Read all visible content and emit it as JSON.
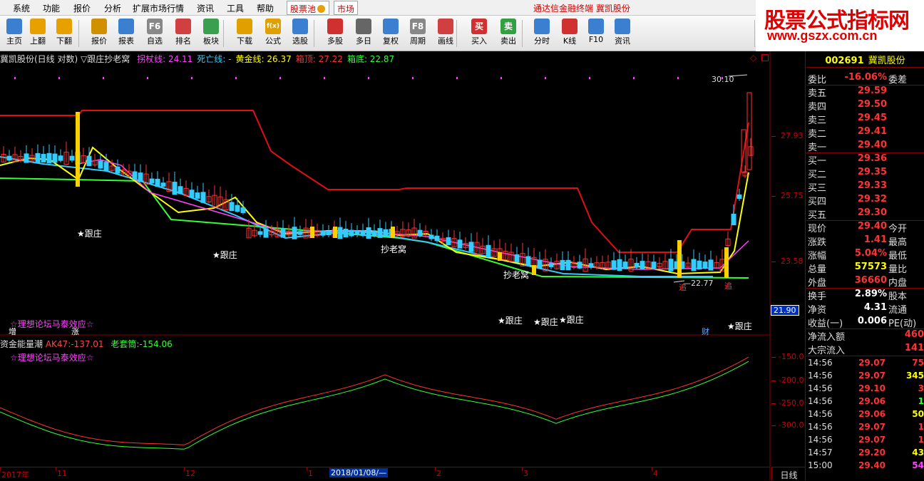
{
  "menu": {
    "items": [
      "系统",
      "功能",
      "报价",
      "分析",
      "扩展市场行情",
      "资讯",
      "工具",
      "帮助"
    ],
    "tab_pool": "股票池",
    "tab_market": "市场",
    "title": "通达信金融终端  冀凯股份"
  },
  "toolbar": {
    "buttons": [
      {
        "label": "主页",
        "icon": "home-icon"
      },
      {
        "label": "上翻",
        "icon": "up-arrow-icon"
      },
      {
        "label": "下翻",
        "icon": "down-arrow-icon"
      },
      {
        "label": "报价",
        "icon": "quote-icon"
      },
      {
        "label": "报表",
        "icon": "report-icon"
      },
      {
        "label": "自选",
        "icon": "f6-icon",
        "glyph": "F6"
      },
      {
        "label": "排名",
        "icon": "rank-icon"
      },
      {
        "label": "板块",
        "icon": "sector-icon"
      },
      {
        "label": "下载",
        "icon": "download-icon"
      },
      {
        "label": "公式",
        "icon": "formula-icon",
        "glyph": "f(x)"
      },
      {
        "label": "选股",
        "icon": "stock-select-icon"
      },
      {
        "label": "多股",
        "icon": "multi-stock-icon"
      },
      {
        "label": "多日",
        "icon": "multi-day-icon"
      },
      {
        "label": "复权",
        "icon": "restore-icon"
      },
      {
        "label": "周期",
        "icon": "f8-icon",
        "glyph": "F8"
      },
      {
        "label": "画线",
        "icon": "draw-line-icon"
      },
      {
        "label": "买入",
        "icon": "buy-icon",
        "glyph": "买"
      },
      {
        "label": "卖出",
        "icon": "sell-icon",
        "glyph": "卖"
      },
      {
        "label": "分时",
        "icon": "intraday-icon"
      },
      {
        "label": "K线",
        "icon": "kline-icon"
      },
      {
        "label": "F10",
        "icon": "f10-icon"
      },
      {
        "label": "资讯",
        "icon": "news-icon"
      }
    ]
  },
  "brand": {
    "title": "股票公式指标网",
    "url": "www.gszx.com.cn"
  },
  "price_header": {
    "name": "冀凯股份(日线 对数)",
    "formula": "▽跟庄抄老窝",
    "items": [
      {
        "label": "拐杖线:",
        "value": "24.11",
        "color": "#ff44ff"
      },
      {
        "label": "死亡线:",
        "value": "-",
        "color": "#33ccff"
      },
      {
        "label": "黄金线:",
        "value": "26.37",
        "color": "#ffff00"
      },
      {
        "label": "箱顶:",
        "value": "27.22",
        "color": "#ff3333"
      },
      {
        "label": "箱底:",
        "value": "22.87",
        "color": "#33ff33"
      }
    ]
  },
  "price_axis": [
    "27.93",
    "25.75",
    "23.58",
    "21.90"
  ],
  "price_markers": {
    "high": "30.10",
    "low": "22.77"
  },
  "chart_labels": {
    "gen_zhuang": "★跟庄",
    "chao_lao_wo": "抄老窝",
    "forum": "☆理想论坛马泰效应☆",
    "zeng": "增",
    "zhang": "涨",
    "cai": "财",
    "zhui": "追"
  },
  "indicator_header": {
    "name": "资金能量潮",
    "ak_label": "AK47:",
    "ak_value": "-137.01",
    "lt_label": "老套筒:",
    "lt_value": "-154.06",
    "forum": "☆理想论坛马泰效应☆"
  },
  "indicator_axis": [
    "-150.0",
    "-200.0",
    "-250.0",
    "-300.0"
  ],
  "x_axis": [
    "2017年",
    "11",
    "12",
    "1",
    "2018/01/08/—",
    "2",
    "3",
    "4"
  ],
  "period_label": "日线",
  "quote": {
    "code": "002691",
    "name": "冀凯股份",
    "weibi": {
      "label": "委比",
      "value": "-16.06%",
      "right": "委差"
    },
    "asks": [
      {
        "label": "卖五",
        "price": "29.59"
      },
      {
        "label": "卖四",
        "price": "29.50"
      },
      {
        "label": "卖三",
        "price": "29.45"
      },
      {
        "label": "卖二",
        "price": "29.41"
      },
      {
        "label": "卖一",
        "price": "29.40"
      }
    ],
    "bids": [
      {
        "label": "买一",
        "price": "29.36"
      },
      {
        "label": "买二",
        "price": "29.35"
      },
      {
        "label": "买三",
        "price": "29.33"
      },
      {
        "label": "买四",
        "price": "29.32"
      },
      {
        "label": "买五",
        "price": "29.30"
      }
    ],
    "stats": [
      {
        "label": "现价",
        "value": "29.40",
        "color": "#ff3333",
        "right": "今开"
      },
      {
        "label": "涨跌",
        "value": "1.41",
        "color": "#ff3333",
        "right": "最高"
      },
      {
        "label": "涨幅",
        "value": "5.04%",
        "color": "#ff3333",
        "right": "最低"
      },
      {
        "label": "总量",
        "value": "57573",
        "color": "#ffff00",
        "right": "量比"
      },
      {
        "label": "外盘",
        "value": "36660",
        "color": "#ff3333",
        "right": "内盘"
      }
    ],
    "stats2": [
      {
        "label": "换手",
        "value": "2.89%",
        "color": "#ffffff",
        "right": "股本"
      },
      {
        "label": "净资",
        "value": "4.31",
        "color": "#ffffff",
        "right": "流通"
      },
      {
        "label": "收益(一)",
        "value": "0.006",
        "color": "#ffffff",
        "right": "PE(动)"
      }
    ],
    "flows": [
      {
        "label": "净流入额",
        "value": "460"
      },
      {
        "label": "大宗流入",
        "value": "141"
      }
    ],
    "ticks": [
      {
        "time": "14:56",
        "price": "29.07",
        "vol": "75",
        "color": "#ff3333"
      },
      {
        "time": "14:56",
        "price": "29.07",
        "vol": "345",
        "color": "#ffff00"
      },
      {
        "time": "14:56",
        "price": "29.10",
        "vol": "3",
        "color": "#ff3333"
      },
      {
        "time": "14:56",
        "price": "29.06",
        "vol": "1",
        "color": "#33ff33"
      },
      {
        "time": "14:56",
        "price": "29.06",
        "vol": "50",
        "color": "#ffff00"
      },
      {
        "time": "14:56",
        "price": "29.07",
        "vol": "1",
        "color": "#ff3333"
      },
      {
        "time": "14:56",
        "price": "29.07",
        "vol": "1",
        "color": "#ff3333"
      },
      {
        "time": "14:57",
        "price": "29.20",
        "vol": "43",
        "color": "#ffff00"
      },
      {
        "time": "15:00",
        "price": "29.40",
        "vol": "54",
        "color": "#ff44ff"
      }
    ]
  }
}
